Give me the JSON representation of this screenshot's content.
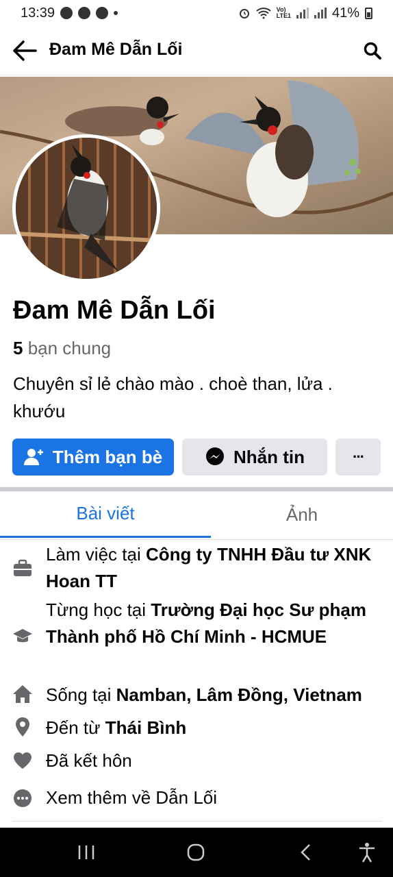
{
  "status_bar": {
    "time": "13:39",
    "battery": "41%"
  },
  "header": {
    "title": "Đam Mê Dẫn Lối"
  },
  "profile": {
    "name": "Đam Mê Dẫn Lối",
    "mutual_count": "5",
    "mutual_label": "bạn chung",
    "bio": "Chuyên sỉ lẻ chào mào . choè than, lửa . khướu"
  },
  "actions": {
    "add_friend": "Thêm bạn bè",
    "message": "Nhắn tin",
    "more": "···"
  },
  "tabs": [
    {
      "label": "Bài viết"
    },
    {
      "label": "Ảnh"
    }
  ],
  "intro": {
    "work_prefix": "Làm việc tại ",
    "work_value": "Công ty TNHH Đầu tư XNK Hoan TT",
    "study_prefix": "Từng học tại ",
    "study_value": "Trường Đại học Sư phạm Thành phố Hồ Chí Minh - HCMUE",
    "lives_prefix": "Sống tại ",
    "lives_value": "Namban, Lâm Đồng, Vietnam",
    "from_prefix": "Đến từ ",
    "from_value": "Thái Bình",
    "relationship": "Đã kết hôn",
    "see_more": "Xem thêm về Dẫn Lối"
  },
  "colors": {
    "accent": "#1b74e4",
    "secondary_button": "#e4e6eb",
    "muted_text": "#65676b"
  }
}
